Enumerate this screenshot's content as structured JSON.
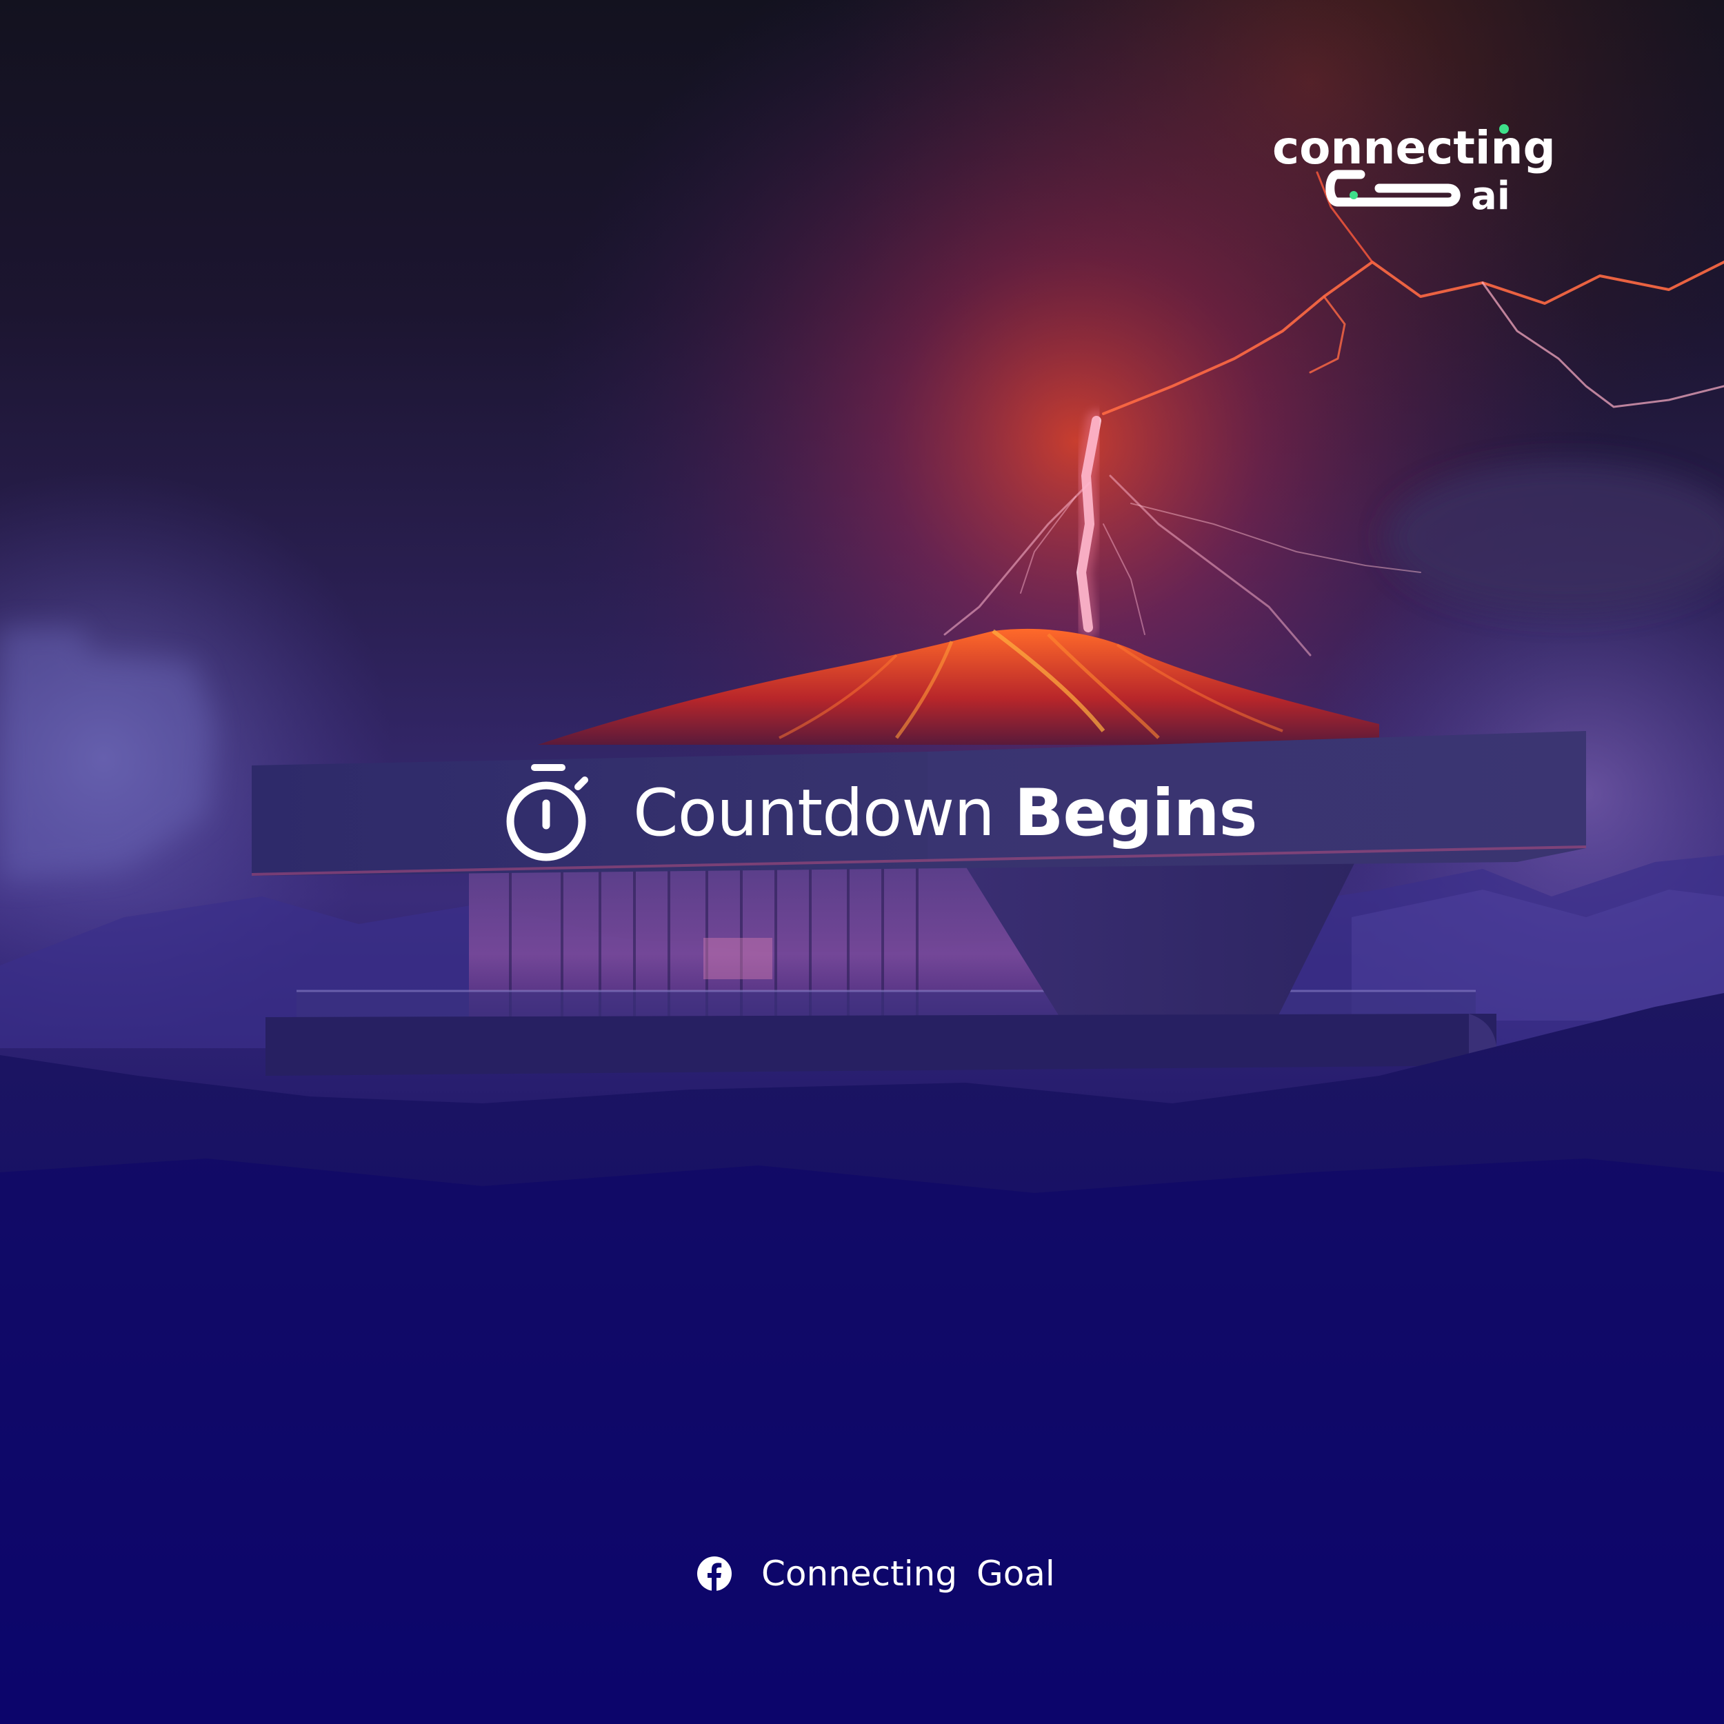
{
  "logo": {
    "line1": "connecting",
    "line2": "ai",
    "dot_color": "#3ee08a"
  },
  "headline": {
    "icon": "stopwatch-icon",
    "word_regular": "Countdown",
    "word_bold": "Begins"
  },
  "footer": {
    "icon": "facebook-icon",
    "label": "Connecting Goal"
  },
  "colors": {
    "background_top": "#151226",
    "background_bottom": "#0b0470",
    "lava": "#ff4a1c",
    "lightning": "#ff5a3c",
    "text": "#ffffff"
  }
}
